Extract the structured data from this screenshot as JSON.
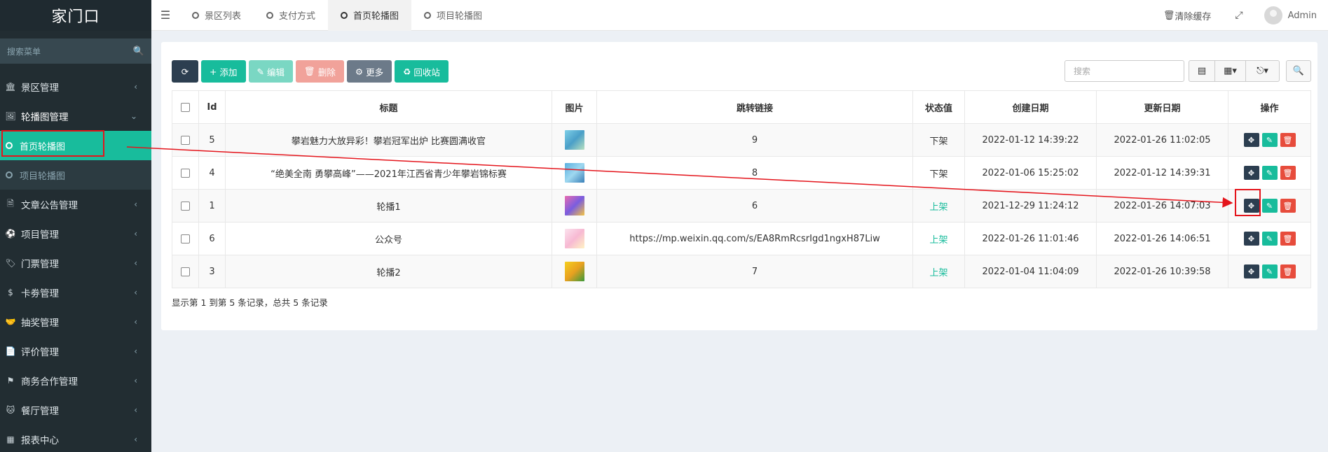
{
  "brand": "家门口",
  "sidebar": {
    "search_placeholder": "搜索菜单",
    "items": [
      {
        "label": "景区管理",
        "icon": "bank-icon",
        "chevron": "‹"
      },
      {
        "label": "轮播图管理",
        "icon": "image-icon",
        "chevron": "⌄"
      },
      {
        "label": "首页轮播图",
        "icon": "circle-icon",
        "sub": true,
        "active": true
      },
      {
        "label": "项目轮播图",
        "icon": "circle-icon",
        "sub": true
      },
      {
        "label": "文章公告管理",
        "icon": "file-icon",
        "chevron": "‹"
      },
      {
        "label": "项目管理",
        "icon": "soccer-icon",
        "chevron": "‹"
      },
      {
        "label": "门票管理",
        "icon": "ticket-icon",
        "chevron": "‹"
      },
      {
        "label": "卡劵管理",
        "icon": "dollar-icon",
        "chevron": "‹"
      },
      {
        "label": "抽奖管理",
        "icon": "handshake-icon",
        "chevron": "‹"
      },
      {
        "label": "评价管理",
        "icon": "document-icon",
        "chevron": "‹"
      },
      {
        "label": "商务合作管理",
        "icon": "flag-icon",
        "chevron": "‹"
      },
      {
        "label": "餐厅管理",
        "icon": "github-icon",
        "chevron": "‹"
      },
      {
        "label": "报表中心",
        "icon": "table-icon",
        "chevron": "‹"
      }
    ]
  },
  "topbar": {
    "tabs": [
      "景区列表",
      "支付方式",
      "首页轮播图",
      "项目轮播图"
    ],
    "active_tab": 2,
    "clear_cache": "清除缓存",
    "user": "Admin"
  },
  "toolbar": {
    "add": "添加",
    "edit": "编辑",
    "delete": "删除",
    "more": "更多",
    "recycle": "回收站",
    "search_placeholder": "搜索"
  },
  "table": {
    "headers": [
      "Id",
      "标题",
      "图片",
      "跳转链接",
      "状态值",
      "创建日期",
      "更新日期",
      "操作"
    ],
    "rows": [
      {
        "id": "5",
        "title": "攀岩魅力大放异彩！攀岩冠军出炉 比赛圆满收官",
        "thumb": "thumb-1",
        "link": "9",
        "status": "下架",
        "status_type": "down",
        "created": "2022-01-12 14:39:22",
        "updated": "2022-01-26 11:02:05"
      },
      {
        "id": "4",
        "title": "“绝美全南 勇攀高峰”——2021年江西省青少年攀岩锦标赛",
        "thumb": "thumb-2",
        "link": "8",
        "status": "下架",
        "status_type": "down",
        "created": "2022-01-06 15:25:02",
        "updated": "2022-01-12 14:39:31"
      },
      {
        "id": "1",
        "title": "轮播1",
        "thumb": "thumb-3",
        "link": "6",
        "status": "上架",
        "status_type": "up",
        "created": "2021-12-29 11:24:12",
        "updated": "2022-01-26 14:07:03"
      },
      {
        "id": "6",
        "title": "公众号",
        "thumb": "thumb-4",
        "link": "https://mp.weixin.qq.com/s/EA8RmRcsrIgd1ngxH87Liw",
        "status": "上架",
        "status_type": "up",
        "created": "2022-01-26 11:01:46",
        "updated": "2022-01-26 14:06:51"
      },
      {
        "id": "3",
        "title": "轮播2",
        "thumb": "thumb-5",
        "link": "7",
        "status": "上架",
        "status_type": "up",
        "created": "2022-01-04 11:04:09",
        "updated": "2022-01-26 10:39:58"
      }
    ]
  },
  "footer": "显示第 1 到第 5 条记录，总共 5 条记录",
  "colors": {
    "accent": "#18bc9c",
    "sidebar": "#222d32",
    "danger": "#e74c3c",
    "dark": "#2c3e50",
    "annotation": "#e4141b"
  }
}
